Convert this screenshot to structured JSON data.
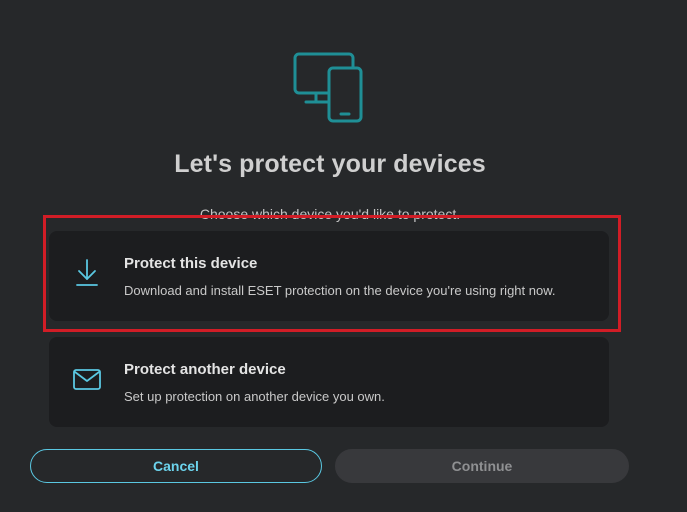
{
  "dialog": {
    "hero_icon": "devices-icon",
    "title": "Let's protect your devices",
    "subtitle": "Choose which device you'd like to protect."
  },
  "options": [
    {
      "icon": "download-icon",
      "title": "Protect this device",
      "description": "Download and install ESET protection on the device you're using right now.",
      "highlighted": true
    },
    {
      "icon": "envelope-icon",
      "title": "Protect another device",
      "description": "Set up protection on another device you own.",
      "highlighted": false
    }
  ],
  "buttons": {
    "cancel_label": "Cancel",
    "continue_label": "Continue",
    "continue_enabled": false
  },
  "colors": {
    "accent": "#1f8f96",
    "link": "#6cd3ec",
    "highlight": "#d11d26",
    "background": "#26282a",
    "card": "#1c1d1f"
  }
}
